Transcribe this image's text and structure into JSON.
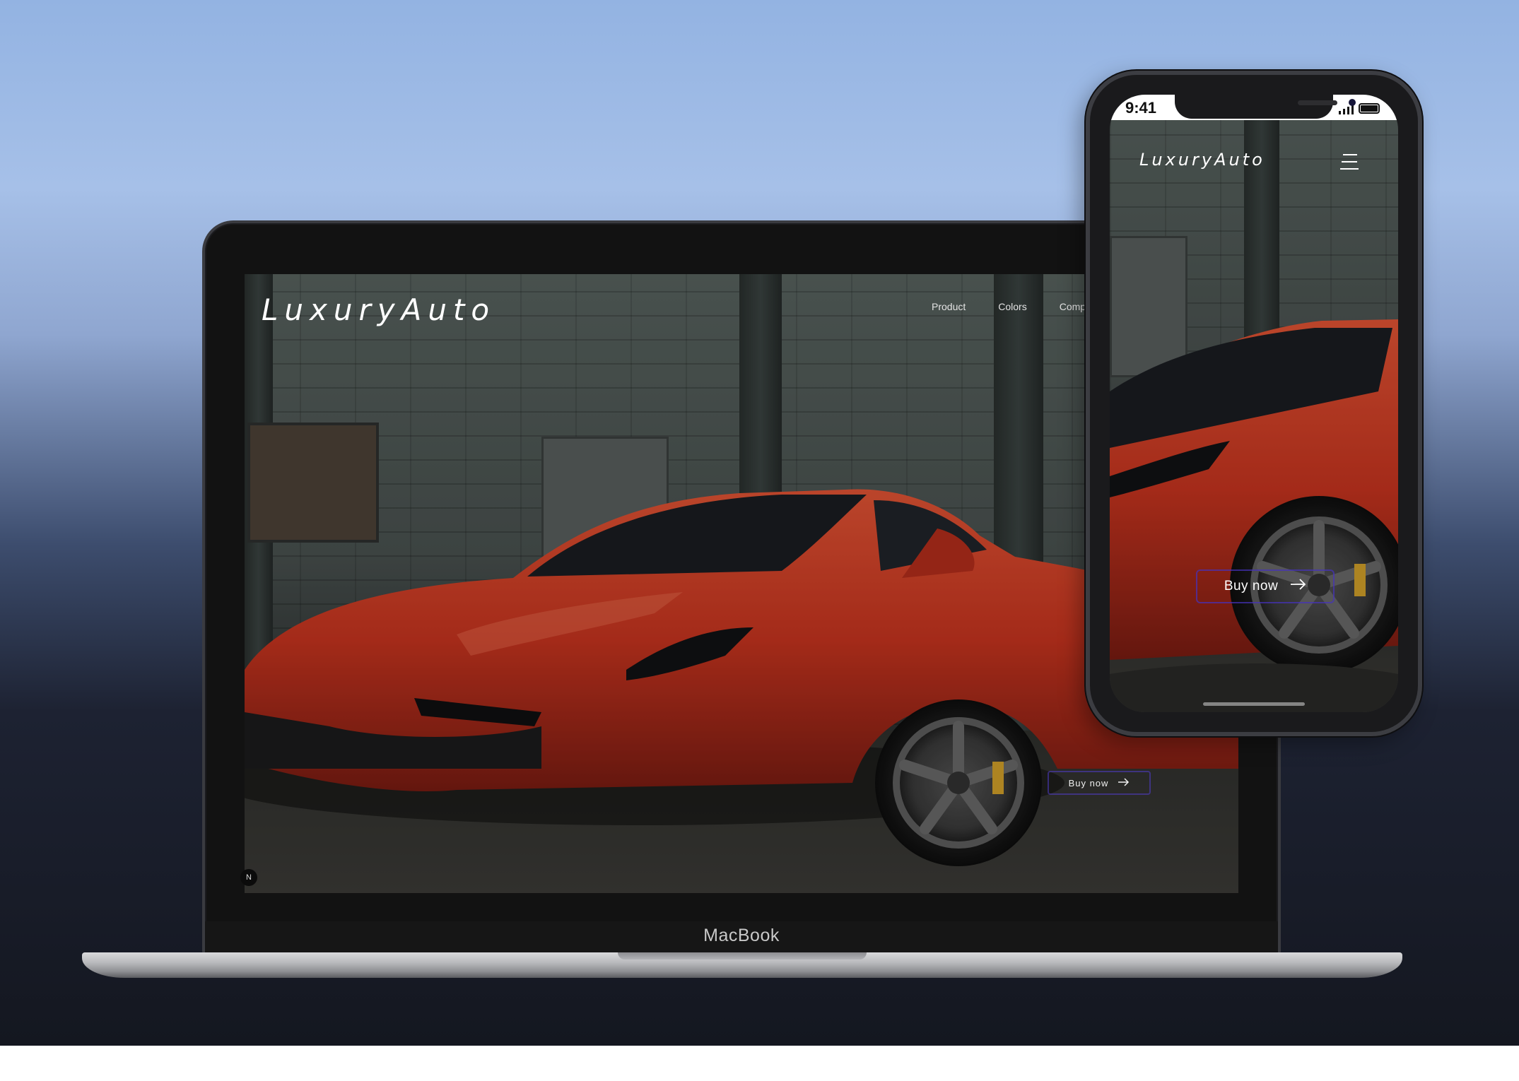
{
  "laptop": {
    "device_label": "MacBook",
    "site": {
      "logo": "LuxuryAuto",
      "nav": [
        "Product",
        "Colors",
        "Compan"
      ],
      "cta_label": "Buy now",
      "cta_icon": "arrow-right-icon",
      "badge_text": "N"
    }
  },
  "phone": {
    "status_time": "9:41",
    "site": {
      "logo": "LuxuryAuto",
      "menu_icon": "hamburger-menu-icon",
      "cta_label": "Buy now",
      "cta_icon": "arrow-right-icon"
    }
  },
  "colors": {
    "car_red": "#d23b24",
    "cta_border": "#4a34c2",
    "background_top": "#a6c0e8",
    "background_bottom": "#141720"
  }
}
